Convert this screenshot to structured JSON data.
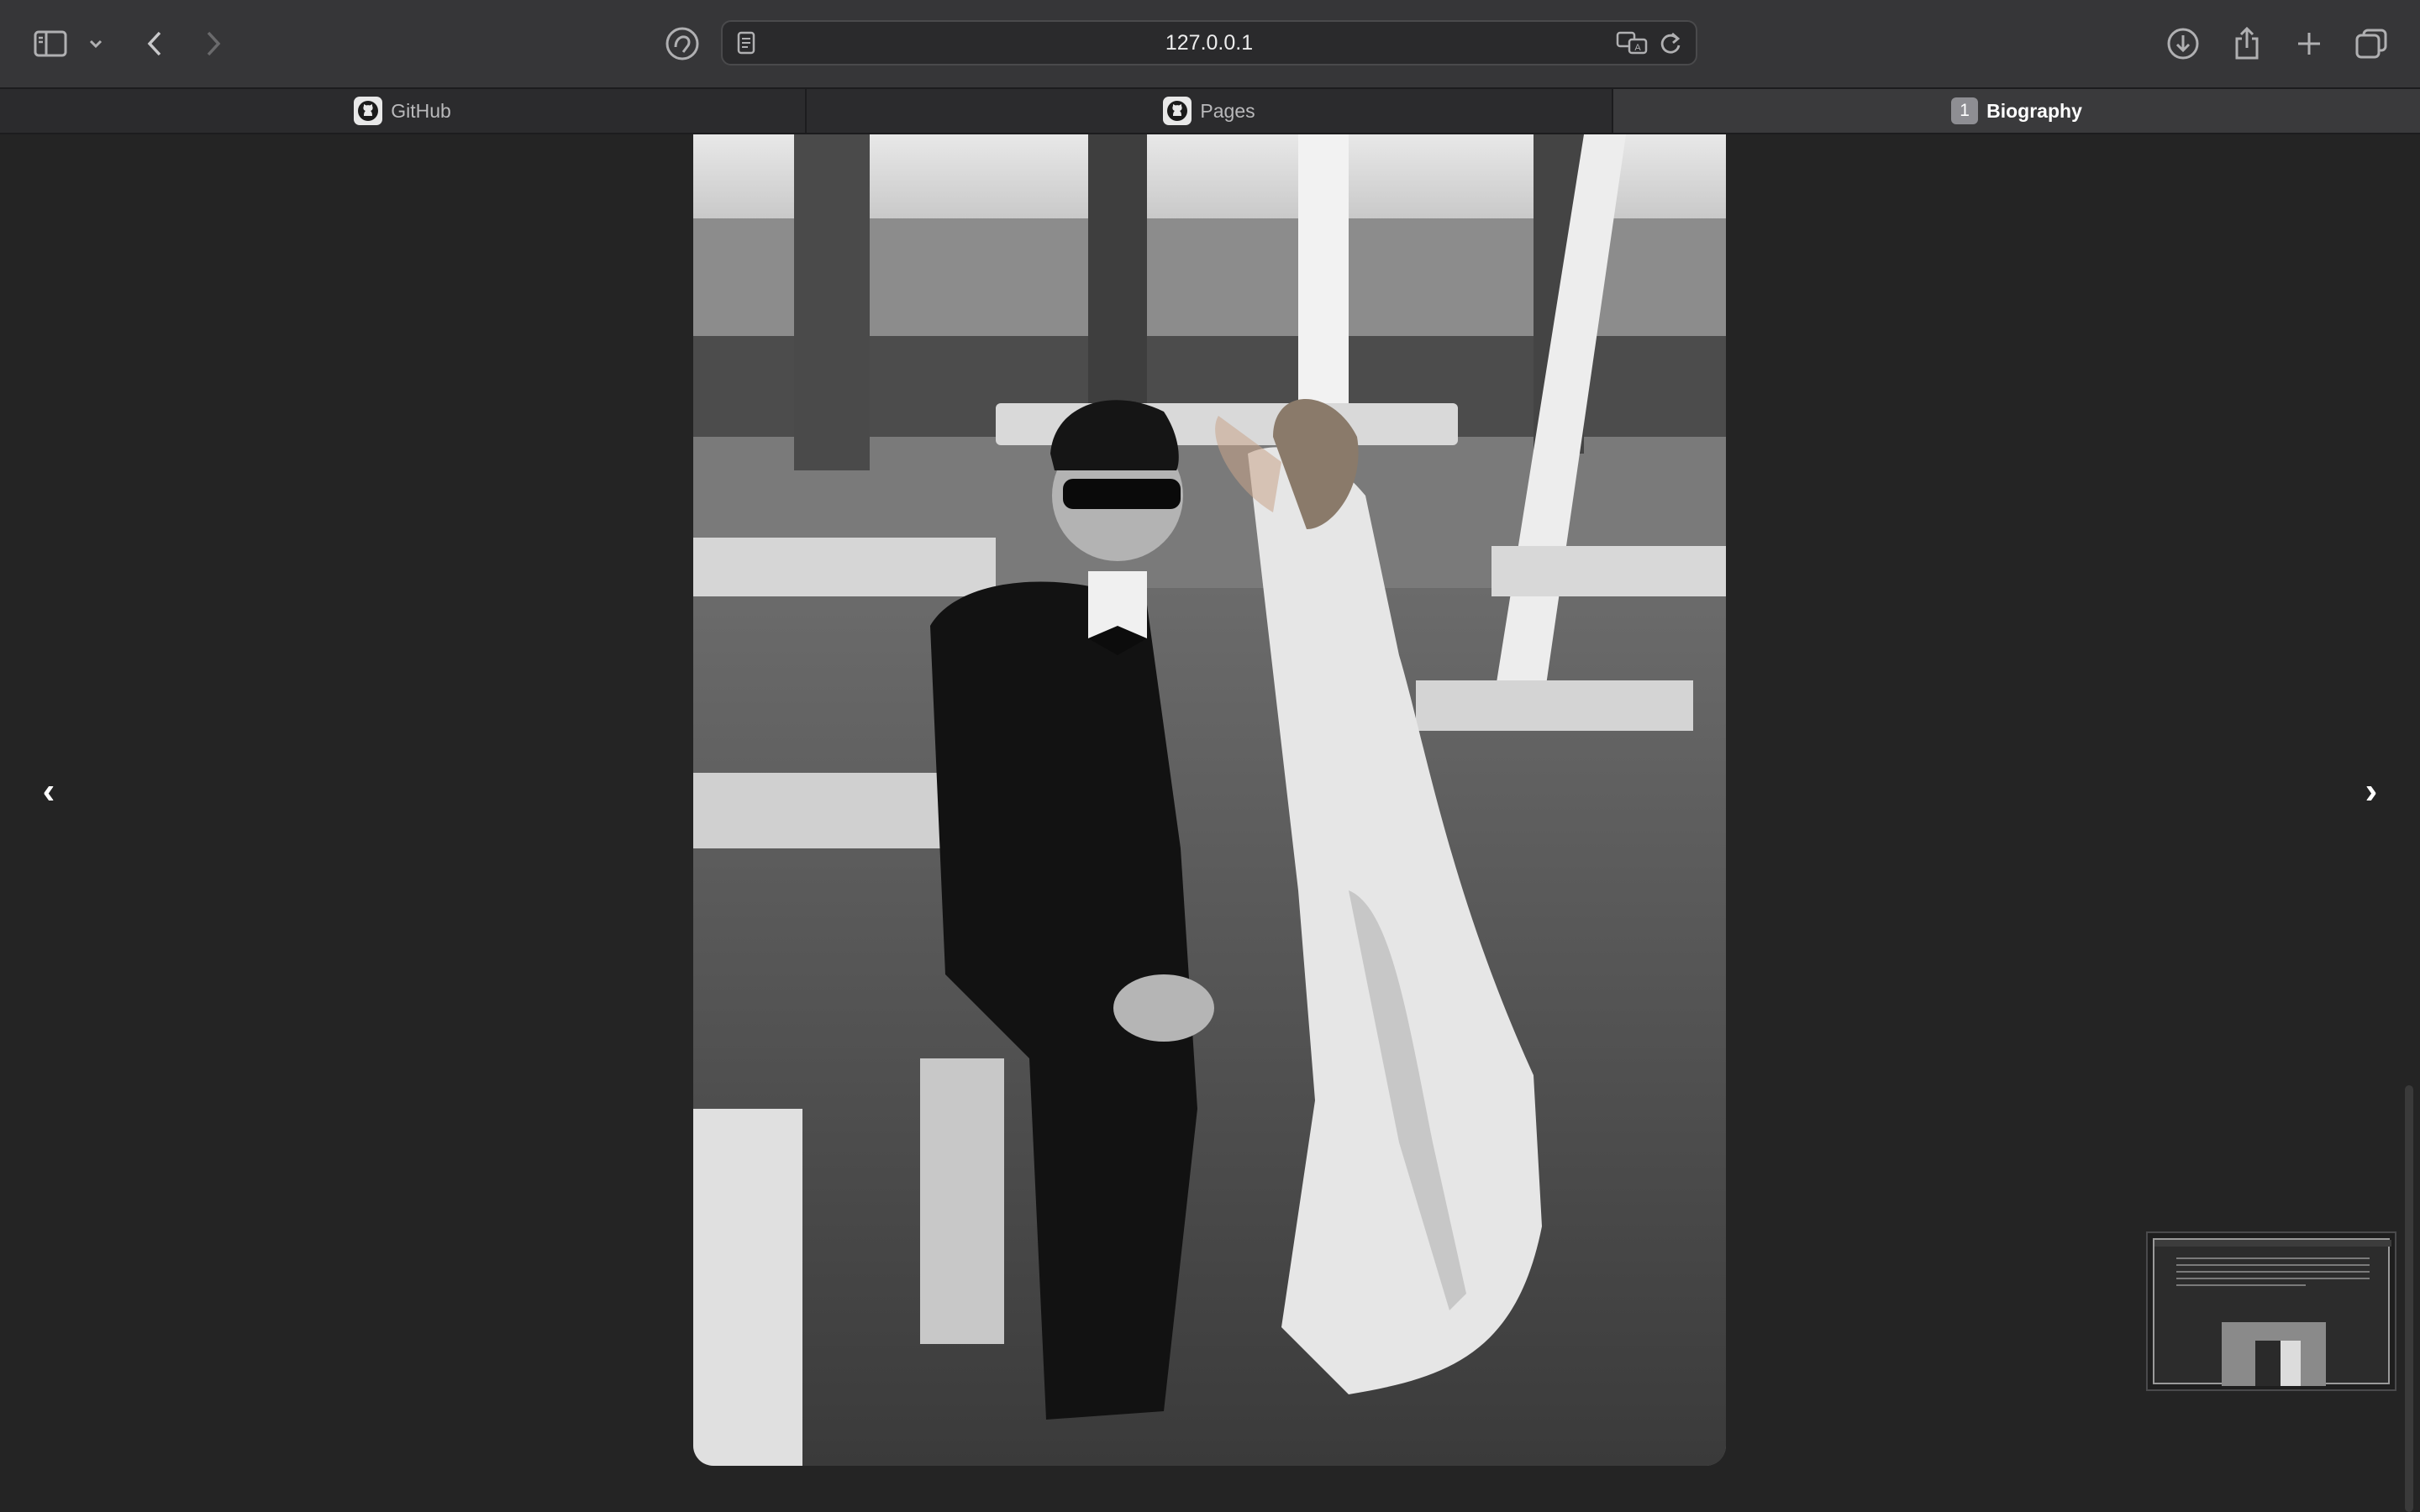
{
  "browser": {
    "url": "127.0.0.1",
    "tabs": [
      {
        "label": "GitHub",
        "icon": "github-icon",
        "active": false
      },
      {
        "label": "Pages",
        "icon": "github-icon",
        "active": false
      },
      {
        "label": "Biography",
        "badge": "1",
        "active": true
      }
    ]
  },
  "viewer": {
    "prev_label": "‹",
    "next_label": "›"
  },
  "colors": {
    "background": "#242424",
    "toolbar": "#363638",
    "tab_active": "#3a3a3c"
  }
}
